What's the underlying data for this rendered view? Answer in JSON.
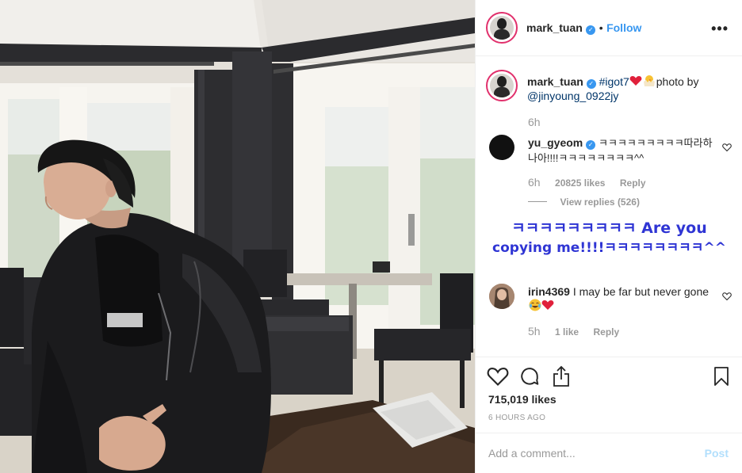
{
  "post": {
    "author": "mark_tuan",
    "follow_label": "Follow",
    "more_label": "•••",
    "verified_label": "✓"
  },
  "caption": {
    "username": "mark_tuan",
    "hashtag": "#igot7",
    "text_after": "photo by",
    "mention": "@jinyoung_0922jy",
    "time": "6h"
  },
  "comments": [
    {
      "username": "yu_gyeom",
      "text": "ㅋㅋㅋㅋㅋㅋㅋㅋㅋ따라하나아!!!!ㅋㅋㅋㅋㅋㅋㅋㅋ^^",
      "time": "6h",
      "likes": "20825 likes",
      "reply": "Reply",
      "view_replies": "View replies (526)"
    },
    {
      "username": "irin4369",
      "text": "I may be far but never gone",
      "time": "5h",
      "likes": "1 like",
      "reply": "Reply"
    }
  ],
  "overlay": {
    "line1": "ㅋㅋㅋㅋㅋㅋㅋㅋㅋ Are you",
    "line2": "copying me!!!!ㅋㅋㅋㅋㅋㅋㅋㅋ^^"
  },
  "actions": {
    "likes": "715,019 likes",
    "time_ago": "6 HOURS AGO"
  },
  "add_comment": {
    "placeholder": "Add a comment...",
    "post_label": "Post"
  },
  "colors": {
    "link_blue": "#3897f0",
    "overlay_blue": "#2f35d4",
    "heart_red": "#ed4956"
  }
}
